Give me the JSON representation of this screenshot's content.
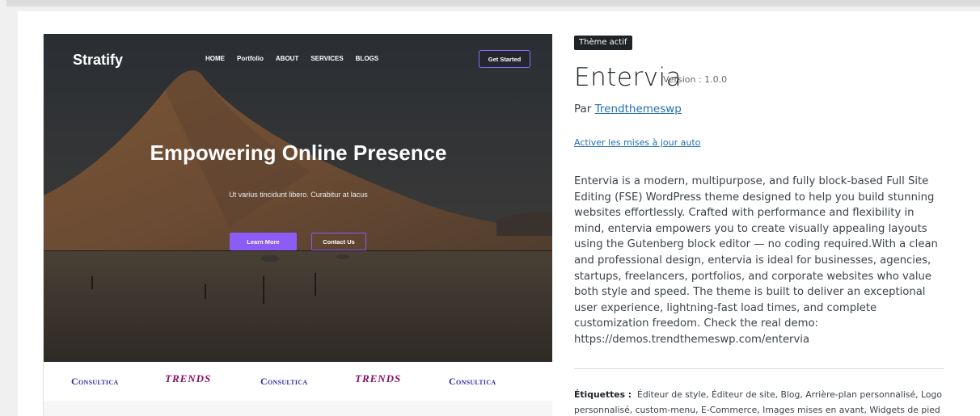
{
  "preview": {
    "brand": "Stratify",
    "nav": [
      "HOME",
      "Portfolio",
      "ABOUT",
      "SERVICES",
      "BLOGS"
    ],
    "cta": "Get Started",
    "hero_title": "Empowering Online Presence",
    "hero_subtitle": "Ut varius tincidunt libero. Curabitur at lacus",
    "learn_more": "Learn More",
    "contact_us": "Contact Us",
    "logos": [
      "Consultica",
      "TRENDS",
      "Consultica",
      "TRENDS",
      "Consultica"
    ],
    "accent_color": "#8b5cf6"
  },
  "theme": {
    "active_badge": "Thème actif",
    "name": "Entervia",
    "version": "Version : 1.0.0",
    "author_prefix": "Par",
    "author": "Trendthemeswp",
    "auto_update_link": "Activer les mises à jour auto",
    "description": "Entervia is a modern, multipurpose, and fully block-based Full Site Editing (FSE) WordPress theme designed to help you build stunning websites effortlessly. Crafted with performance and flexibility in mind, entervia empowers you to create visually appealing layouts using the Gutenberg block editor — no coding required.With a clean and professional design, entervia is ideal for businesses, agencies, startups, freelancers, portfolios, and corporate websites who value both style and speed. The theme is built to deliver an exceptional user experience, lightning-fast load times, and complete customization freedom. Check the real demo: https://demos.trendthemeswp.com/entervia",
    "tags_label": "Étiquettes :",
    "tags": "Éditeur de style, Éditeur de site, Blog, Arrière-plan personnalisé, Logo personnalisé, custom-menu, E-Commerce, Images mises en avant, Widgets de pied",
    "link_color": "#2271b1"
  }
}
